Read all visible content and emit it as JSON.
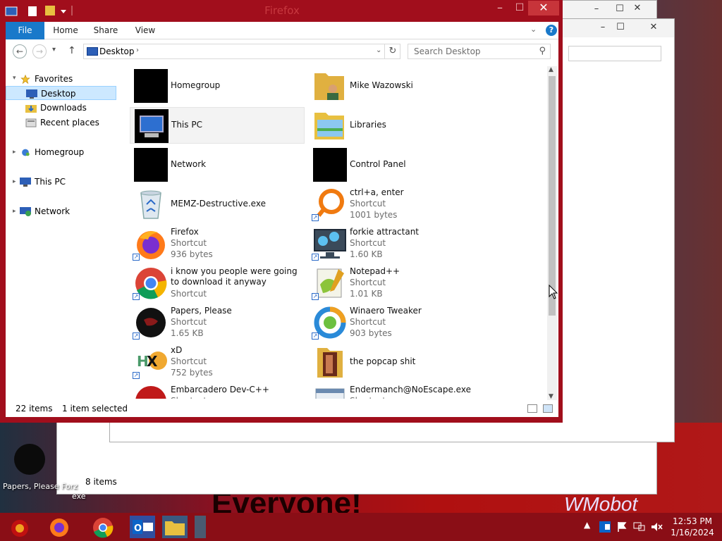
{
  "window": {
    "title": "Firefox",
    "minimize": "–",
    "maximize": "☐",
    "close": "✕"
  },
  "background_windows": {
    "status_items": "8 items",
    "min": "–",
    "max": "☐",
    "close": "✕"
  },
  "ribbon": {
    "tabs": [
      "File",
      "Home",
      "Share",
      "View"
    ],
    "help": "?"
  },
  "navigation": {
    "back": "←",
    "forward": "→",
    "history": "▾",
    "up": "↑",
    "address": "Desktop",
    "address_sep": "›",
    "address_dropdown": "⌄",
    "refresh": "↻",
    "search_placeholder": "Search Desktop",
    "search_icon": "⚲"
  },
  "nav_pane": {
    "favorites": "Favorites",
    "items": [
      {
        "label": "Desktop",
        "selected": true
      },
      {
        "label": "Downloads"
      },
      {
        "label": "Recent places"
      }
    ],
    "groups": [
      "Homegroup",
      "This PC",
      "Network"
    ]
  },
  "files": [
    {
      "name": "Homegroup",
      "icon": "black-square-icon"
    },
    {
      "name": "Mike Wazowski",
      "icon": "user-folder-icon"
    },
    {
      "name": "This PC",
      "icon": "this-pc-icon",
      "hovered": true
    },
    {
      "name": "Libraries",
      "icon": "libraries-icon"
    },
    {
      "name": "Network",
      "icon": "black-square-icon"
    },
    {
      "name": "Control Panel",
      "icon": "black-square-icon"
    },
    {
      "name": "MEMZ-Destructive.exe",
      "icon": "recycle-bin-icon"
    },
    {
      "name": "ctrl+a, enter",
      "type": "Shortcut",
      "size": "1001 bytes",
      "icon": "orange-ring-icon"
    },
    {
      "name": "Firefox",
      "type": "Shortcut",
      "size": "936 bytes",
      "icon": "firefox-icon"
    },
    {
      "name": "forkie attractant",
      "type": "Shortcut",
      "size": "1.60 KB",
      "icon": "gear-monitor-icon"
    },
    {
      "name": "i know you people were going to download it anyway",
      "type": "Shortcut",
      "icon": "chrome-icon"
    },
    {
      "name": "Notepad++",
      "type": "Shortcut",
      "size": "1.01 KB",
      "icon": "notepad-plus-plus-icon"
    },
    {
      "name": "Papers, Please",
      "type": "Shortcut",
      "size": "1.65 KB",
      "icon": "papers-please-icon"
    },
    {
      "name": "Winaero Tweaker",
      "type": "Shortcut",
      "size": "903 bytes",
      "icon": "winaero-icon"
    },
    {
      "name": "xD",
      "type": "Shortcut",
      "size": "752 bytes",
      "icon": "hxd-icon"
    },
    {
      "name": "the popcap shit",
      "icon": "folder-icon"
    },
    {
      "name": "Embarcadero Dev-C++",
      "type": "Shortcut",
      "icon": "devcpp-icon"
    },
    {
      "name": "Endermanch@NoEscape.exe",
      "type": "Shortcut",
      "icon": "window-app-icon"
    }
  ],
  "status": {
    "count": "22 items",
    "selected": "1 item selected"
  },
  "desktop": {
    "icon_label": "Papers, Please Forz",
    "icon_label2": "exe",
    "wallpaper_text": "Everyone!",
    "wallpaper_text2": "WMobot"
  },
  "taskbar": {
    "time": "12:53 PM",
    "date": "1/16/2024",
    "tray_up": "▲"
  },
  "colors": {
    "title_bar": "#a10e1c",
    "close_button": "#c7343a",
    "file_tab": "#1979ca",
    "selection": "#cce8ff",
    "taskbar": "#8a0e16"
  }
}
